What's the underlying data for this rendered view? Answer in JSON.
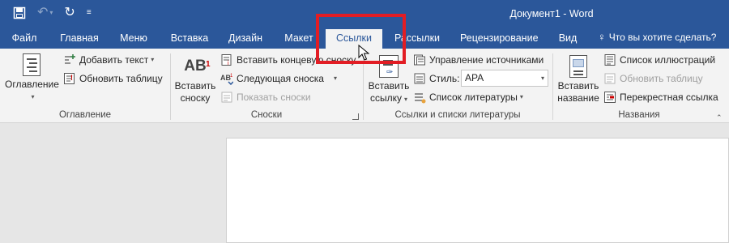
{
  "window": {
    "title": "Документ1 - Word",
    "accent_color": "#2b579a",
    "highlight_color": "#e21d24"
  },
  "quick_access": {
    "icons": [
      "save-icon",
      "undo-icon",
      "redo-icon",
      "customize-icon"
    ]
  },
  "tabs": [
    {
      "label": "Файл"
    },
    {
      "label": "Главная"
    },
    {
      "label": "Меню"
    },
    {
      "label": "Вставка"
    },
    {
      "label": "Дизайн"
    },
    {
      "label": "Макет"
    },
    {
      "label": "Ссылки",
      "active": true
    },
    {
      "label": "Рассылки"
    },
    {
      "label": "Рецензирование"
    },
    {
      "label": "Вид"
    }
  ],
  "tell_me": "Что вы хотите сделать?",
  "ribbon": {
    "toc_group": {
      "label": "Оглавление",
      "toc_button": "Оглавление",
      "add_text": "Добавить текст",
      "update_table": "Обновить таблицу"
    },
    "footnotes_group": {
      "label": "Сноски",
      "insert_footnote_line1": "Вставить",
      "insert_footnote_line2": "сноску",
      "insert_endnote": "Вставить концевую сноску",
      "next_footnote": "Следующая сноска",
      "show_notes": "Показать сноски"
    },
    "citations_group": {
      "label": "Ссылки и списки литературы",
      "insert_citation_line1": "Вставить",
      "insert_citation_line2": "ссылку",
      "manage_sources": "Управление источниками",
      "style_label": "Стиль:",
      "style_value": "APA",
      "bibliography": "Список литературы"
    },
    "captions_group": {
      "label": "Названия",
      "insert_caption_line1": "Вставить",
      "insert_caption_line2": "название",
      "table_of_figures": "Список иллюстраций",
      "update_table": "Обновить таблицу",
      "cross_reference": "Перекрестная ссылка"
    }
  }
}
